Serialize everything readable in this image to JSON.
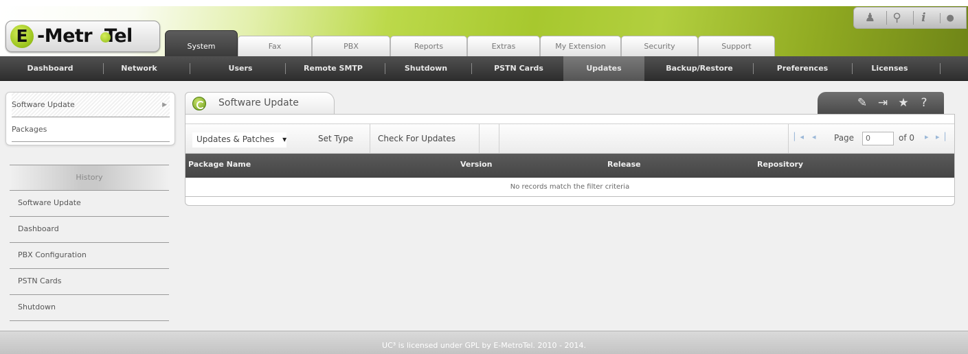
{
  "logo": {
    "letter": "E",
    "text": "-Metr  Tel"
  },
  "top_icons": [
    {
      "name": "user-icon",
      "glyph": "♟"
    },
    {
      "name": "search-icon",
      "glyph": "⚲"
    },
    {
      "name": "info-icon",
      "glyph": "i"
    },
    {
      "name": "drop-icon",
      "glyph": "●"
    }
  ],
  "main_tabs": [
    "System",
    "Fax",
    "PBX",
    "Reports",
    "Extras",
    "My Extension",
    "Security",
    "Support"
  ],
  "active_main_tab": "System",
  "subnav": [
    "Dashboard",
    "Network",
    "Users",
    "Remote SMTP",
    "Shutdown",
    "PSTN Cards",
    "Updates",
    "Backup/Restore",
    "Preferences",
    "Licenses"
  ],
  "active_subnav": "Updates",
  "sidebar": {
    "items": [
      "Software Update",
      "Packages"
    ],
    "history_title": "History",
    "history_items": [
      "Software Update",
      "Dashboard",
      "PBX Configuration",
      "PSTN Cards",
      "Shutdown"
    ]
  },
  "panel": {
    "title": "Software Update",
    "tools": [
      {
        "name": "edit-icon",
        "glyph": "✎"
      },
      {
        "name": "pin-icon",
        "glyph": "⇥"
      },
      {
        "name": "star-icon",
        "glyph": "★"
      },
      {
        "name": "help-icon",
        "glyph": "?"
      }
    ],
    "toolbar": {
      "type_select": "Updates & Patches",
      "type_select_arrow": "▾",
      "set_type": "Set Type",
      "check_updates": "Check For Updates"
    },
    "pager": {
      "first": "▏◂",
      "prev": "◂",
      "page_label": "Page",
      "page_value": "0",
      "of_label": "of 0",
      "next": "▸",
      "last": "▸▕"
    },
    "columns": [
      "Package Name",
      "Version",
      "Release",
      "Repository"
    ],
    "empty_message": "No records match the filter criteria"
  },
  "footer": "UC³ is licensed under GPL by E-MetroTel. 2010 - 2014."
}
